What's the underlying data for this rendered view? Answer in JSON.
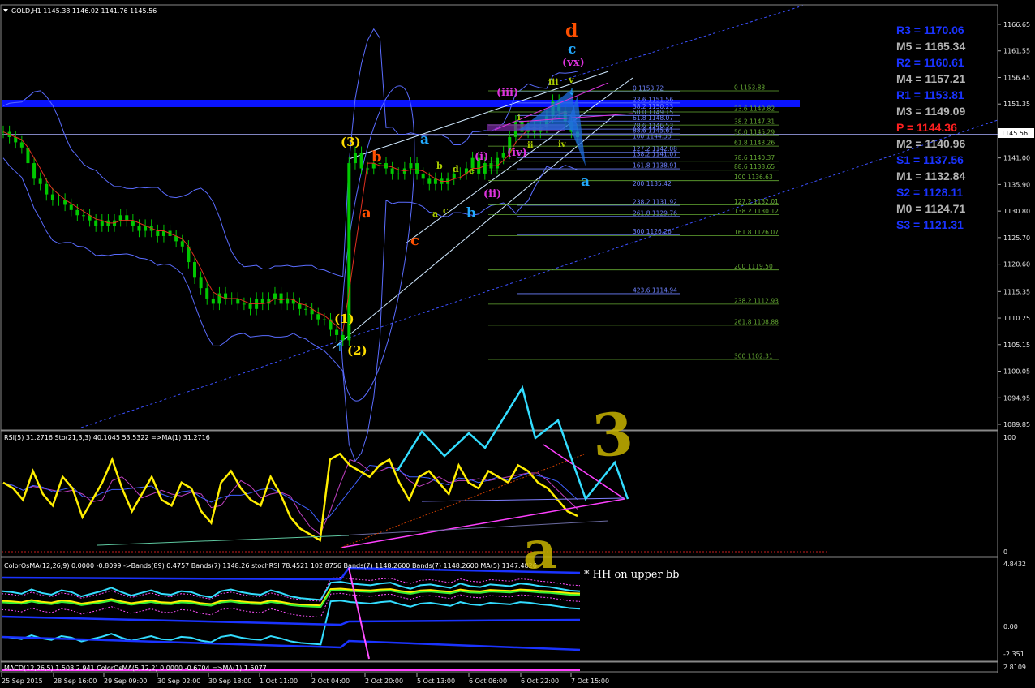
{
  "window": {
    "symbol_header": "GOLD,H1  1145.38 1146.02 1141.76 1145.56",
    "current_price_tag": "1145.56"
  },
  "colors": {
    "background": "#000000",
    "candle": "#00c800",
    "pivot_blue": "#1a33ff",
    "pivot_gray": "#b4b4b4",
    "pivot_red": "#ff2020",
    "resistance_band": "#0a14ff",
    "channel": "#3c50ff",
    "fib_green": "#66aa33",
    "fib_blue": "#6e82ff"
  },
  "chart_data": [
    {
      "type": "candlestick",
      "title": "GOLD,H1",
      "ohlc_last": {
        "open": 1145.38,
        "high": 1146.02,
        "low": 1141.76,
        "close": 1145.56
      },
      "ylim": [
        1088,
        1170
      ],
      "yticks": [
        "1166.65",
        "1161.55",
        "1156.45",
        "1151.35",
        "1146.00",
        "1141.00",
        "1135.90",
        "1130.80",
        "1125.70",
        "1120.60",
        "1115.35",
        "1110.25",
        "1105.15",
        "1100.05",
        "1094.95",
        "1089.85"
      ],
      "xticks": [
        "25 Sep 2015",
        "28 Sep 16:00",
        "29 Sep 09:00",
        "30 Sep 02:00",
        "30 Sep 18:00",
        "1 Oct 11:00",
        "2 Oct 04:00",
        "2 Oct 20:00",
        "5 Oct 13:00",
        "6 Oct 06:00",
        "6 Oct 22:00",
        "7 Oct 15:00"
      ],
      "close_path": [
        1146,
        1145,
        1144,
        1143,
        1140,
        1137,
        1136,
        1134,
        1133,
        1133,
        1132,
        1131,
        1130,
        1130,
        1129,
        1128,
        1129,
        1128,
        1129,
        1130,
        1129,
        1128,
        1127,
        1128,
        1127,
        1126,
        1127,
        1126,
        1125,
        1124,
        1121,
        1118,
        1116,
        1114,
        1113,
        1115,
        1114,
        1114,
        1113,
        1113,
        1112,
        1114,
        1113,
        1114,
        1115,
        1113,
        1114,
        1113,
        1112,
        1112,
        1111,
        1110,
        1110,
        1108,
        1107,
        1106,
        1140,
        1142,
        1139,
        1139,
        1140,
        1140,
        1139,
        1138,
        1138,
        1139,
        1140,
        1138,
        1137,
        1136,
        1137,
        1136,
        1137,
        1138,
        1138,
        1139,
        1141,
        1138,
        1140,
        1139,
        1141,
        1142,
        1145,
        1148,
        1146,
        1147,
        1146,
        1147,
        1149,
        1152,
        1150,
        1148,
        1146,
        1145
      ],
      "pivots": [
        {
          "label": "R3 = 1170.06",
          "value": 1170.06,
          "color": "#1a33ff"
        },
        {
          "label": "M5 = 1165.34",
          "value": 1165.34,
          "color": "#b4b4b4"
        },
        {
          "label": "R2 = 1160.61",
          "value": 1160.61,
          "color": "#1a33ff"
        },
        {
          "label": "M4 = 1157.21",
          "value": 1157.21,
          "color": "#b4b4b4"
        },
        {
          "label": "R1 = 1153.81",
          "value": 1153.81,
          "color": "#1a33ff"
        },
        {
          "label": "M3 = 1149.09",
          "value": 1149.09,
          "color": "#b4b4b4"
        },
        {
          "label": "P  = 1144.36",
          "value": 1144.36,
          "color": "#ff2020"
        },
        {
          "label": "M2 = 1140.96",
          "value": 1140.96,
          "color": "#b4b4b4"
        },
        {
          "label": "S1 = 1137.56",
          "value": 1137.56,
          "color": "#1a33ff"
        },
        {
          "label": "M1 = 1132.84",
          "value": 1132.84,
          "color": "#b4b4b4"
        },
        {
          "label": "S2 = 1128.11",
          "value": 1128.11,
          "color": "#1a33ff"
        },
        {
          "label": "M0 = 1124.71",
          "value": 1124.71,
          "color": "#b4b4b4"
        },
        {
          "label": "S3 = 1121.31",
          "value": 1121.31,
          "color": "#1a33ff"
        }
      ],
      "fib_left": [
        {
          "label": "0 1153.72",
          "value": 1153.72
        },
        {
          "label": "23.6 1151.56",
          "value": 1151.56
        },
        {
          "label": "38.2 1150.23",
          "value": 1150.23
        },
        {
          "label": "50.0 1149.15",
          "value": 1149.15
        },
        {
          "label": "61.8 1148.07",
          "value": 1148.07
        },
        {
          "label": "78.6 1146.53",
          "value": 1146.53
        },
        {
          "label": "88.6 1145.61",
          "value": 1145.61
        },
        {
          "label": "100 1144.53",
          "value": 1144.53
        },
        {
          "label": "127.2 1142.08",
          "value": 1142.08
        },
        {
          "label": "138.2 1141.07",
          "value": 1141.07
        },
        {
          "label": "161.8 1138.91",
          "value": 1138.91
        },
        {
          "label": "200 1135.42",
          "value": 1135.42
        },
        {
          "label": "238.2 1131.92",
          "value": 1131.92
        },
        {
          "label": "261.8 1129.76",
          "value": 1129.76
        },
        {
          "label": "300 1126.26",
          "value": 1126.26
        },
        {
          "label": "423.6 1114.94",
          "value": 1114.94
        }
      ],
      "fib_right": [
        {
          "label": "0 1153.88",
          "value": 1153.88
        },
        {
          "label": "23.6 1149.82",
          "value": 1149.82
        },
        {
          "label": "38.2 1147.31",
          "value": 1147.31
        },
        {
          "label": "50.0 1145.29",
          "value": 1145.29
        },
        {
          "label": "61.8 1143.26",
          "value": 1143.26
        },
        {
          "label": "78.6 1140.37",
          "value": 1140.37
        },
        {
          "label": "88.6 1138.65",
          "value": 1138.65
        },
        {
          "label": "100 1136.63",
          "value": 1136.63
        },
        {
          "label": "127.2 1132.01",
          "value": 1132.01
        },
        {
          "label": "138.2 1130.12",
          "value": 1130.12
        },
        {
          "label": "161.8 1126.07",
          "value": 1126.07
        },
        {
          "label": "200 1119.50",
          "value": 1119.5
        },
        {
          "label": "238.2 1112.93",
          "value": 1112.93
        },
        {
          "label": "261.8 1108.88",
          "value": 1108.88
        },
        {
          "label": "300 1102.31",
          "value": 1102.31
        }
      ]
    },
    {
      "type": "line",
      "title": "RSI(5) 31.2716  Sto(21,3,3) 40.1045 53.5322  =>MA(1) 31.2716",
      "ylim": [
        0,
        100
      ],
      "yticks": [
        "100",
        "0"
      ],
      "series": [
        {
          "name": "RSI(5)",
          "values": [
            60,
            55,
            45,
            70,
            50,
            40,
            65,
            55,
            30,
            45,
            60,
            80,
            55,
            35,
            50,
            65,
            45,
            40,
            60,
            55,
            35,
            25,
            60,
            70,
            55,
            45,
            40,
            65,
            50,
            30,
            20,
            15,
            10,
            80,
            85,
            75,
            70,
            65,
            75,
            80,
            60,
            45,
            65,
            70,
            60,
            50,
            75,
            60,
            55,
            70,
            65,
            60,
            75,
            70,
            60,
            55,
            45,
            35,
            31
          ]
        }
      ]
    },
    {
      "type": "line",
      "title": "ColorOsMA(12,26,9) 0.0000 -0.8099  ->Bands(89) 0.4757  Bands(7) 1148.26  stochRSI 78.4521 102.8756  Bands(7) 1148.2600  Bands(7) 1148.2600  MA(5) 1147.4826",
      "yticks": [
        "4.8432",
        "0.00",
        "-2.351"
      ]
    },
    {
      "type": "line",
      "title": "MACD(12,26,5) 1.508 2.941  ColorOsMA(5,12,2) 0.0000 -0.6704  =>MA(1) 1.5077",
      "yticks": [
        "2.8109"
      ]
    }
  ],
  "annotations": {
    "wave_labels": [
      {
        "text": "d",
        "color": "#ff5000"
      },
      {
        "text": "c",
        "color": "#22aaff"
      },
      {
        "text": "(vx)",
        "color": "#dd33dd"
      },
      {
        "text": "(iii)",
        "color": "#dd33dd"
      },
      {
        "text": "iii",
        "color": "#aacc00"
      },
      {
        "text": "v",
        "color": "#aacc00"
      },
      {
        "text": "i",
        "color": "#aacc00"
      },
      {
        "text": "ii",
        "color": "#aacc00"
      },
      {
        "text": "iv",
        "color": "#aacc00"
      },
      {
        "text": "(iv)",
        "color": "#dd33dd"
      },
      {
        "text": "(i)",
        "color": "#dd33dd"
      },
      {
        "text": "(ii)",
        "color": "#dd33dd"
      },
      {
        "text": "(3)",
        "color": "#ffdd00"
      },
      {
        "text": "(1)",
        "color": "#ffdd00"
      },
      {
        "text": "(2)",
        "color": "#ffdd00"
      },
      {
        "text": "b",
        "color": "#ff5000"
      },
      {
        "text": "a",
        "color": "#ff5000"
      },
      {
        "text": "c",
        "color": "#ff5000"
      },
      {
        "text": "a",
        "color": "#22aaff"
      },
      {
        "text": "b",
        "color": "#22aaff"
      },
      {
        "text": "a",
        "color": "#22aaff"
      },
      {
        "text": "b",
        "color": "#aacc00"
      },
      {
        "text": "d",
        "color": "#aacc00"
      },
      {
        "text": "a",
        "color": "#aacc00"
      },
      {
        "text": "c",
        "color": "#aacc00"
      },
      {
        "text": "e",
        "color": "#aacc00"
      }
    ],
    "big_three": "3",
    "big_a": "a",
    "note": "* HH on upper bb"
  }
}
